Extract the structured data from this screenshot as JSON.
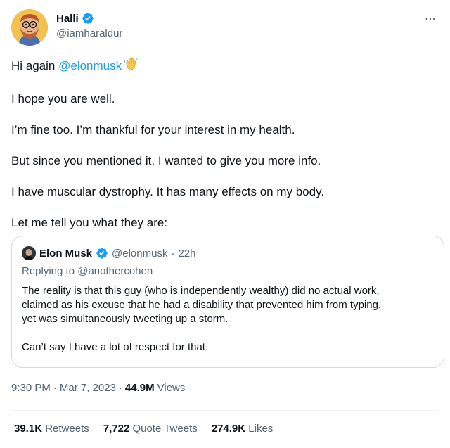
{
  "author": {
    "display_name": "Halli",
    "handle": "@iamharaldur"
  },
  "body": {
    "line1_prefix": "Hi again ",
    "line1_mention": "@elonmusk",
    "paragraphs": [
      "I hope you are well.",
      "I’m fine too. I’m thankful for your interest in my health.",
      "But since you mentioned it, I wanted to give you more info.",
      "I have muscular dystrophy. It has many effects on my body.",
      "Let me tell you what they are:"
    ]
  },
  "quoted_tweet": {
    "display_name": "Elon Musk",
    "handle": "@elonmusk",
    "separator": "·",
    "time_ago": "22h",
    "replying_to": "Replying to @anothercohen",
    "text_lines": [
      "The reality is that this guy (who is independently wealthy) did no actual work,",
      "claimed as his excuse that he had a disability that prevented him from typing,",
      "yet was simultaneously tweeting up a storm."
    ],
    "text_last": "Can’t say I have a lot of respect for that."
  },
  "meta": {
    "time": "9:30 PM",
    "sep1": "·",
    "date": "Mar 7, 2023",
    "sep2": "·",
    "views_count": "44.9M",
    "views_label": "Views"
  },
  "stats": {
    "retweets_count": "39.1K",
    "retweets_label": "Retweets",
    "quotes_count": "7,722",
    "quotes_label": "Quote Tweets",
    "likes_count": "274.9K",
    "likes_label": "Likes"
  },
  "icons": {
    "verified": "verified-badge-icon",
    "more": "more-options-icon",
    "wave": "waving-hands-emoji-icon"
  },
  "colors": {
    "accent": "#1d9bf0",
    "text": "#0f1419",
    "secondary": "#536471",
    "border": "#cfd9de"
  }
}
